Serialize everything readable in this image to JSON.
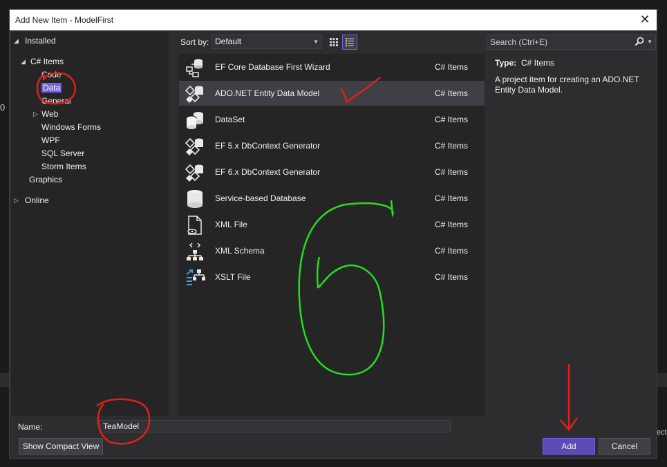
{
  "background": {
    "left_text": "0",
    "right_text": "ect"
  },
  "dialog": {
    "title": "Add New Item - ModelFirst",
    "close_glyph": "✕"
  },
  "tree": {
    "installed": "Installed",
    "csharp_items": "C# Items",
    "children": [
      "Code",
      "Data",
      "General",
      "Web",
      "Windows Forms",
      "WPF",
      "SQL Server",
      "Storm Items"
    ],
    "graphics": "Graphics",
    "online": "Online"
  },
  "toolbar": {
    "sort_label": "Sort by:",
    "sort_value": "Default",
    "search_placeholder": "Search (Ctrl+E)"
  },
  "items": [
    {
      "name": "EF Core Database First Wizard",
      "category": "C# Items",
      "icon": "ef-wizard-icon"
    },
    {
      "name": "ADO.NET Entity Data Model",
      "category": "C# Items",
      "icon": "entity-model-icon"
    },
    {
      "name": "DataSet",
      "category": "C# Items",
      "icon": "dataset-icon"
    },
    {
      "name": "EF 5.x DbContext Generator",
      "category": "C# Items",
      "icon": "dbcontext-icon"
    },
    {
      "name": "EF 6.x DbContext Generator",
      "category": "C# Items",
      "icon": "dbcontext-icon"
    },
    {
      "name": "Service-based Database",
      "category": "C# Items",
      "icon": "database-icon"
    },
    {
      "name": "XML File",
      "category": "C# Items",
      "icon": "xml-file-icon"
    },
    {
      "name": "XML Schema",
      "category": "C# Items",
      "icon": "xml-schema-icon"
    },
    {
      "name": "XSLT File",
      "category": "C# Items",
      "icon": "xslt-file-icon"
    }
  ],
  "details": {
    "type_label": "Type:",
    "type_value": "C# Items",
    "description": "A project item for creating an ADO.NET Entity Data Model."
  },
  "footer": {
    "name_label": "Name:",
    "name_value": "TeaModel",
    "compact_view": "Show Compact View",
    "add": "Add",
    "cancel": "Cancel"
  },
  "colors": {
    "accent": "#7160e8",
    "annotation_red": "#e0201c",
    "annotation_green": "#22e01a"
  }
}
